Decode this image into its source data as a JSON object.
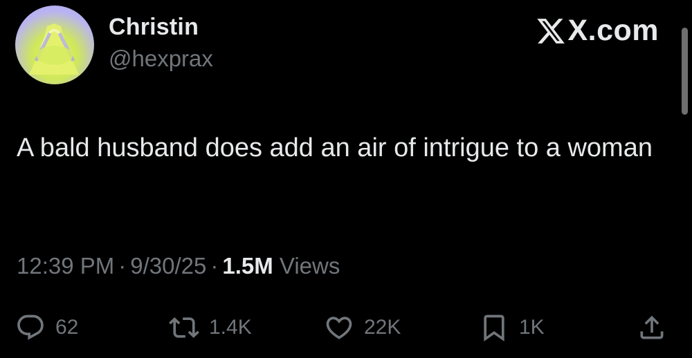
{
  "author": {
    "display_name": "Christin",
    "handle": "@hexprax"
  },
  "brand": {
    "icon": "x-logo-icon",
    "text": "X.com"
  },
  "tweet": {
    "text": "A bald husband does add an air of intrigue to a woman"
  },
  "meta": {
    "time": "12:39 PM",
    "separator": "·",
    "date": "9/30/25",
    "views_count": "1.5M",
    "views_label": "Views"
  },
  "actions": {
    "replies": {
      "icon": "reply-icon",
      "count": "62"
    },
    "reposts": {
      "icon": "repost-icon",
      "count": "1.4K"
    },
    "likes": {
      "icon": "heart-icon",
      "count": "22K"
    },
    "bookmarks": {
      "icon": "bookmark-icon",
      "count": "1K"
    },
    "share": {
      "icon": "share-icon"
    }
  },
  "colors": {
    "background": "#000000",
    "primary_text": "#e7e9ea",
    "secondary_text": "#71767b"
  }
}
